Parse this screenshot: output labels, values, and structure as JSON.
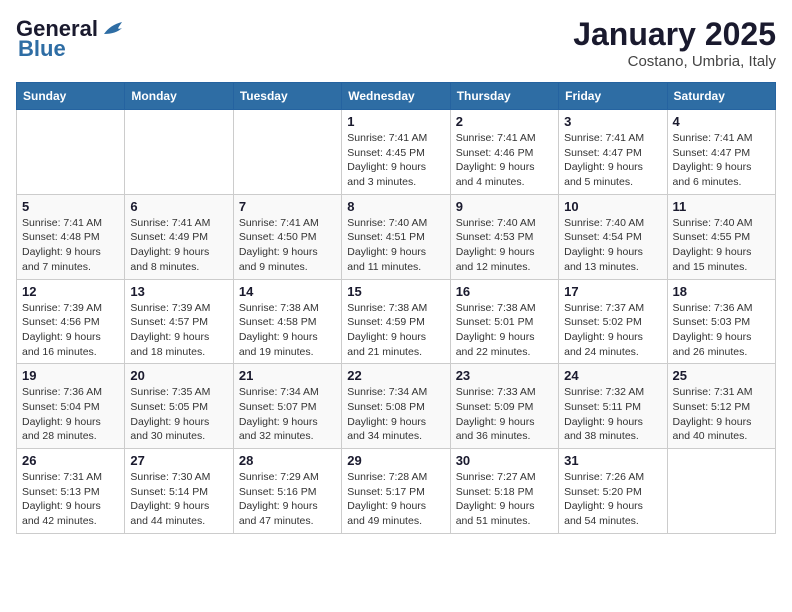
{
  "header": {
    "logo_general": "General",
    "logo_blue": "Blue",
    "title": "January 2025",
    "subtitle": "Costano, Umbria, Italy"
  },
  "days_of_week": [
    "Sunday",
    "Monday",
    "Tuesday",
    "Wednesday",
    "Thursday",
    "Friday",
    "Saturday"
  ],
  "weeks": [
    [
      {
        "day": "",
        "info": ""
      },
      {
        "day": "",
        "info": ""
      },
      {
        "day": "",
        "info": ""
      },
      {
        "day": "1",
        "info": "Sunrise: 7:41 AM\nSunset: 4:45 PM\nDaylight: 9 hours\nand 3 minutes."
      },
      {
        "day": "2",
        "info": "Sunrise: 7:41 AM\nSunset: 4:46 PM\nDaylight: 9 hours\nand 4 minutes."
      },
      {
        "day": "3",
        "info": "Sunrise: 7:41 AM\nSunset: 4:47 PM\nDaylight: 9 hours\nand 5 minutes."
      },
      {
        "day": "4",
        "info": "Sunrise: 7:41 AM\nSunset: 4:47 PM\nDaylight: 9 hours\nand 6 minutes."
      }
    ],
    [
      {
        "day": "5",
        "info": "Sunrise: 7:41 AM\nSunset: 4:48 PM\nDaylight: 9 hours\nand 7 minutes."
      },
      {
        "day": "6",
        "info": "Sunrise: 7:41 AM\nSunset: 4:49 PM\nDaylight: 9 hours\nand 8 minutes."
      },
      {
        "day": "7",
        "info": "Sunrise: 7:41 AM\nSunset: 4:50 PM\nDaylight: 9 hours\nand 9 minutes."
      },
      {
        "day": "8",
        "info": "Sunrise: 7:40 AM\nSunset: 4:51 PM\nDaylight: 9 hours\nand 11 minutes."
      },
      {
        "day": "9",
        "info": "Sunrise: 7:40 AM\nSunset: 4:53 PM\nDaylight: 9 hours\nand 12 minutes."
      },
      {
        "day": "10",
        "info": "Sunrise: 7:40 AM\nSunset: 4:54 PM\nDaylight: 9 hours\nand 13 minutes."
      },
      {
        "day": "11",
        "info": "Sunrise: 7:40 AM\nSunset: 4:55 PM\nDaylight: 9 hours\nand 15 minutes."
      }
    ],
    [
      {
        "day": "12",
        "info": "Sunrise: 7:39 AM\nSunset: 4:56 PM\nDaylight: 9 hours\nand 16 minutes."
      },
      {
        "day": "13",
        "info": "Sunrise: 7:39 AM\nSunset: 4:57 PM\nDaylight: 9 hours\nand 18 minutes."
      },
      {
        "day": "14",
        "info": "Sunrise: 7:38 AM\nSunset: 4:58 PM\nDaylight: 9 hours\nand 19 minutes."
      },
      {
        "day": "15",
        "info": "Sunrise: 7:38 AM\nSunset: 4:59 PM\nDaylight: 9 hours\nand 21 minutes."
      },
      {
        "day": "16",
        "info": "Sunrise: 7:38 AM\nSunset: 5:01 PM\nDaylight: 9 hours\nand 22 minutes."
      },
      {
        "day": "17",
        "info": "Sunrise: 7:37 AM\nSunset: 5:02 PM\nDaylight: 9 hours\nand 24 minutes."
      },
      {
        "day": "18",
        "info": "Sunrise: 7:36 AM\nSunset: 5:03 PM\nDaylight: 9 hours\nand 26 minutes."
      }
    ],
    [
      {
        "day": "19",
        "info": "Sunrise: 7:36 AM\nSunset: 5:04 PM\nDaylight: 9 hours\nand 28 minutes."
      },
      {
        "day": "20",
        "info": "Sunrise: 7:35 AM\nSunset: 5:05 PM\nDaylight: 9 hours\nand 30 minutes."
      },
      {
        "day": "21",
        "info": "Sunrise: 7:34 AM\nSunset: 5:07 PM\nDaylight: 9 hours\nand 32 minutes."
      },
      {
        "day": "22",
        "info": "Sunrise: 7:34 AM\nSunset: 5:08 PM\nDaylight: 9 hours\nand 34 minutes."
      },
      {
        "day": "23",
        "info": "Sunrise: 7:33 AM\nSunset: 5:09 PM\nDaylight: 9 hours\nand 36 minutes."
      },
      {
        "day": "24",
        "info": "Sunrise: 7:32 AM\nSunset: 5:11 PM\nDaylight: 9 hours\nand 38 minutes."
      },
      {
        "day": "25",
        "info": "Sunrise: 7:31 AM\nSunset: 5:12 PM\nDaylight: 9 hours\nand 40 minutes."
      }
    ],
    [
      {
        "day": "26",
        "info": "Sunrise: 7:31 AM\nSunset: 5:13 PM\nDaylight: 9 hours\nand 42 minutes."
      },
      {
        "day": "27",
        "info": "Sunrise: 7:30 AM\nSunset: 5:14 PM\nDaylight: 9 hours\nand 44 minutes."
      },
      {
        "day": "28",
        "info": "Sunrise: 7:29 AM\nSunset: 5:16 PM\nDaylight: 9 hours\nand 47 minutes."
      },
      {
        "day": "29",
        "info": "Sunrise: 7:28 AM\nSunset: 5:17 PM\nDaylight: 9 hours\nand 49 minutes."
      },
      {
        "day": "30",
        "info": "Sunrise: 7:27 AM\nSunset: 5:18 PM\nDaylight: 9 hours\nand 51 minutes."
      },
      {
        "day": "31",
        "info": "Sunrise: 7:26 AM\nSunset: 5:20 PM\nDaylight: 9 hours\nand 54 minutes."
      },
      {
        "day": "",
        "info": ""
      }
    ]
  ]
}
